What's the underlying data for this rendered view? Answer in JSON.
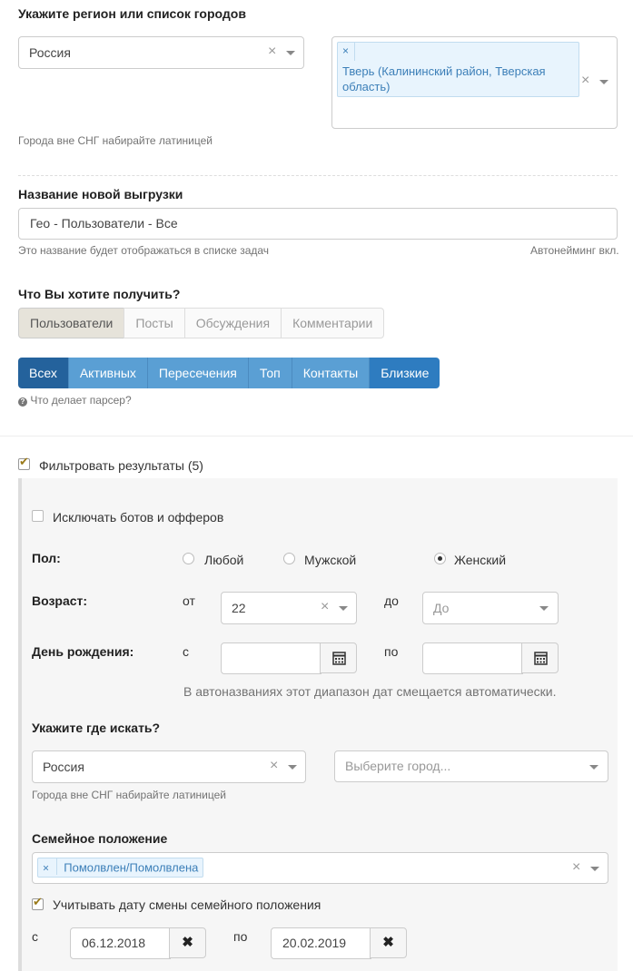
{
  "region": {
    "label": "Укажите регион или список городов",
    "country": "Россия",
    "city_tag": "Тверь (Калининский район, Тверская область)",
    "help": "Города вне СНГ набирайте латиницей"
  },
  "export": {
    "label": "Название новой выгрузки",
    "value": "Гео - Пользователи - Все",
    "help": "Это название будет отображаться в списке задач",
    "autoname": "Автонейминг вкл."
  },
  "get": {
    "label": "Что Вы хотите получить?",
    "tabs": [
      "Пользователи",
      "Посты",
      "Обсуждения",
      "Комментарии"
    ],
    "modes": [
      "Всех",
      "Активных",
      "Пересечения",
      "Топ",
      "Контакты",
      "Близкие"
    ],
    "parser_help": "Что делает парсер?"
  },
  "filter": {
    "label": "Фильтровать результаты (5)",
    "exclude_bots": "Исключать ботов и офферов",
    "gender_label": "Пол:",
    "gender_options": [
      "Любой",
      "Мужской",
      "Женский"
    ],
    "age_label": "Возраст:",
    "age_from_label": "от",
    "age_from": "22",
    "age_to_label": "до",
    "age_to_placeholder": "До",
    "birthday_label": "День рождения:",
    "bday_from_label": "с",
    "bday_to_label": "по",
    "bday_note": "В автоназваниях этот диапазон дат смещается автоматически.",
    "where_label": "Укажите где искать?",
    "where_country": "Россия",
    "where_city_placeholder": "Выберите город...",
    "where_help": "Города вне СНГ набирайте латиницей",
    "family_label": "Семейное положение",
    "family_tag": "Помолвлен/Помолвлена",
    "family_date_check": "Учитывать дату смены семейного положения",
    "fam_from_label": "с",
    "fam_from": "06.12.2018",
    "fam_to_label": "по",
    "fam_to": "20.02.2019"
  },
  "icons": {
    "clear": "×",
    "remove": "✖"
  }
}
